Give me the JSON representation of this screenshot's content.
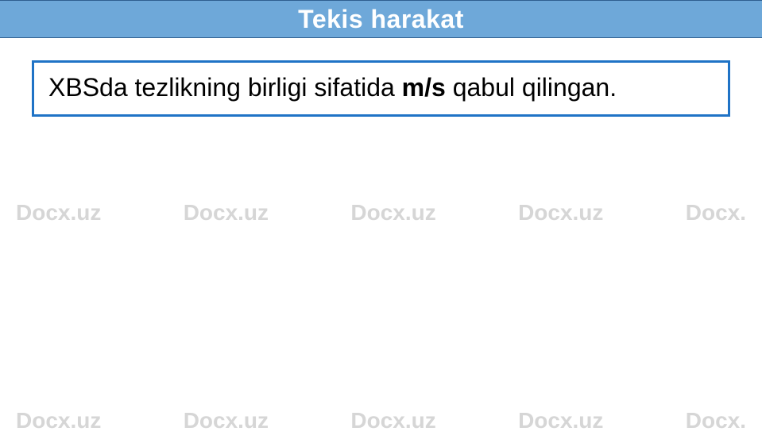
{
  "header": {
    "title": "Tekis harakat"
  },
  "content": {
    "line_prefix": "XBSda tezlikning birligi sifatida ",
    "bold_unit": "m/s",
    "line_suffix": " qabul qilingan."
  },
  "watermark": {
    "text": "Docx.uz",
    "partial": "Docx."
  }
}
